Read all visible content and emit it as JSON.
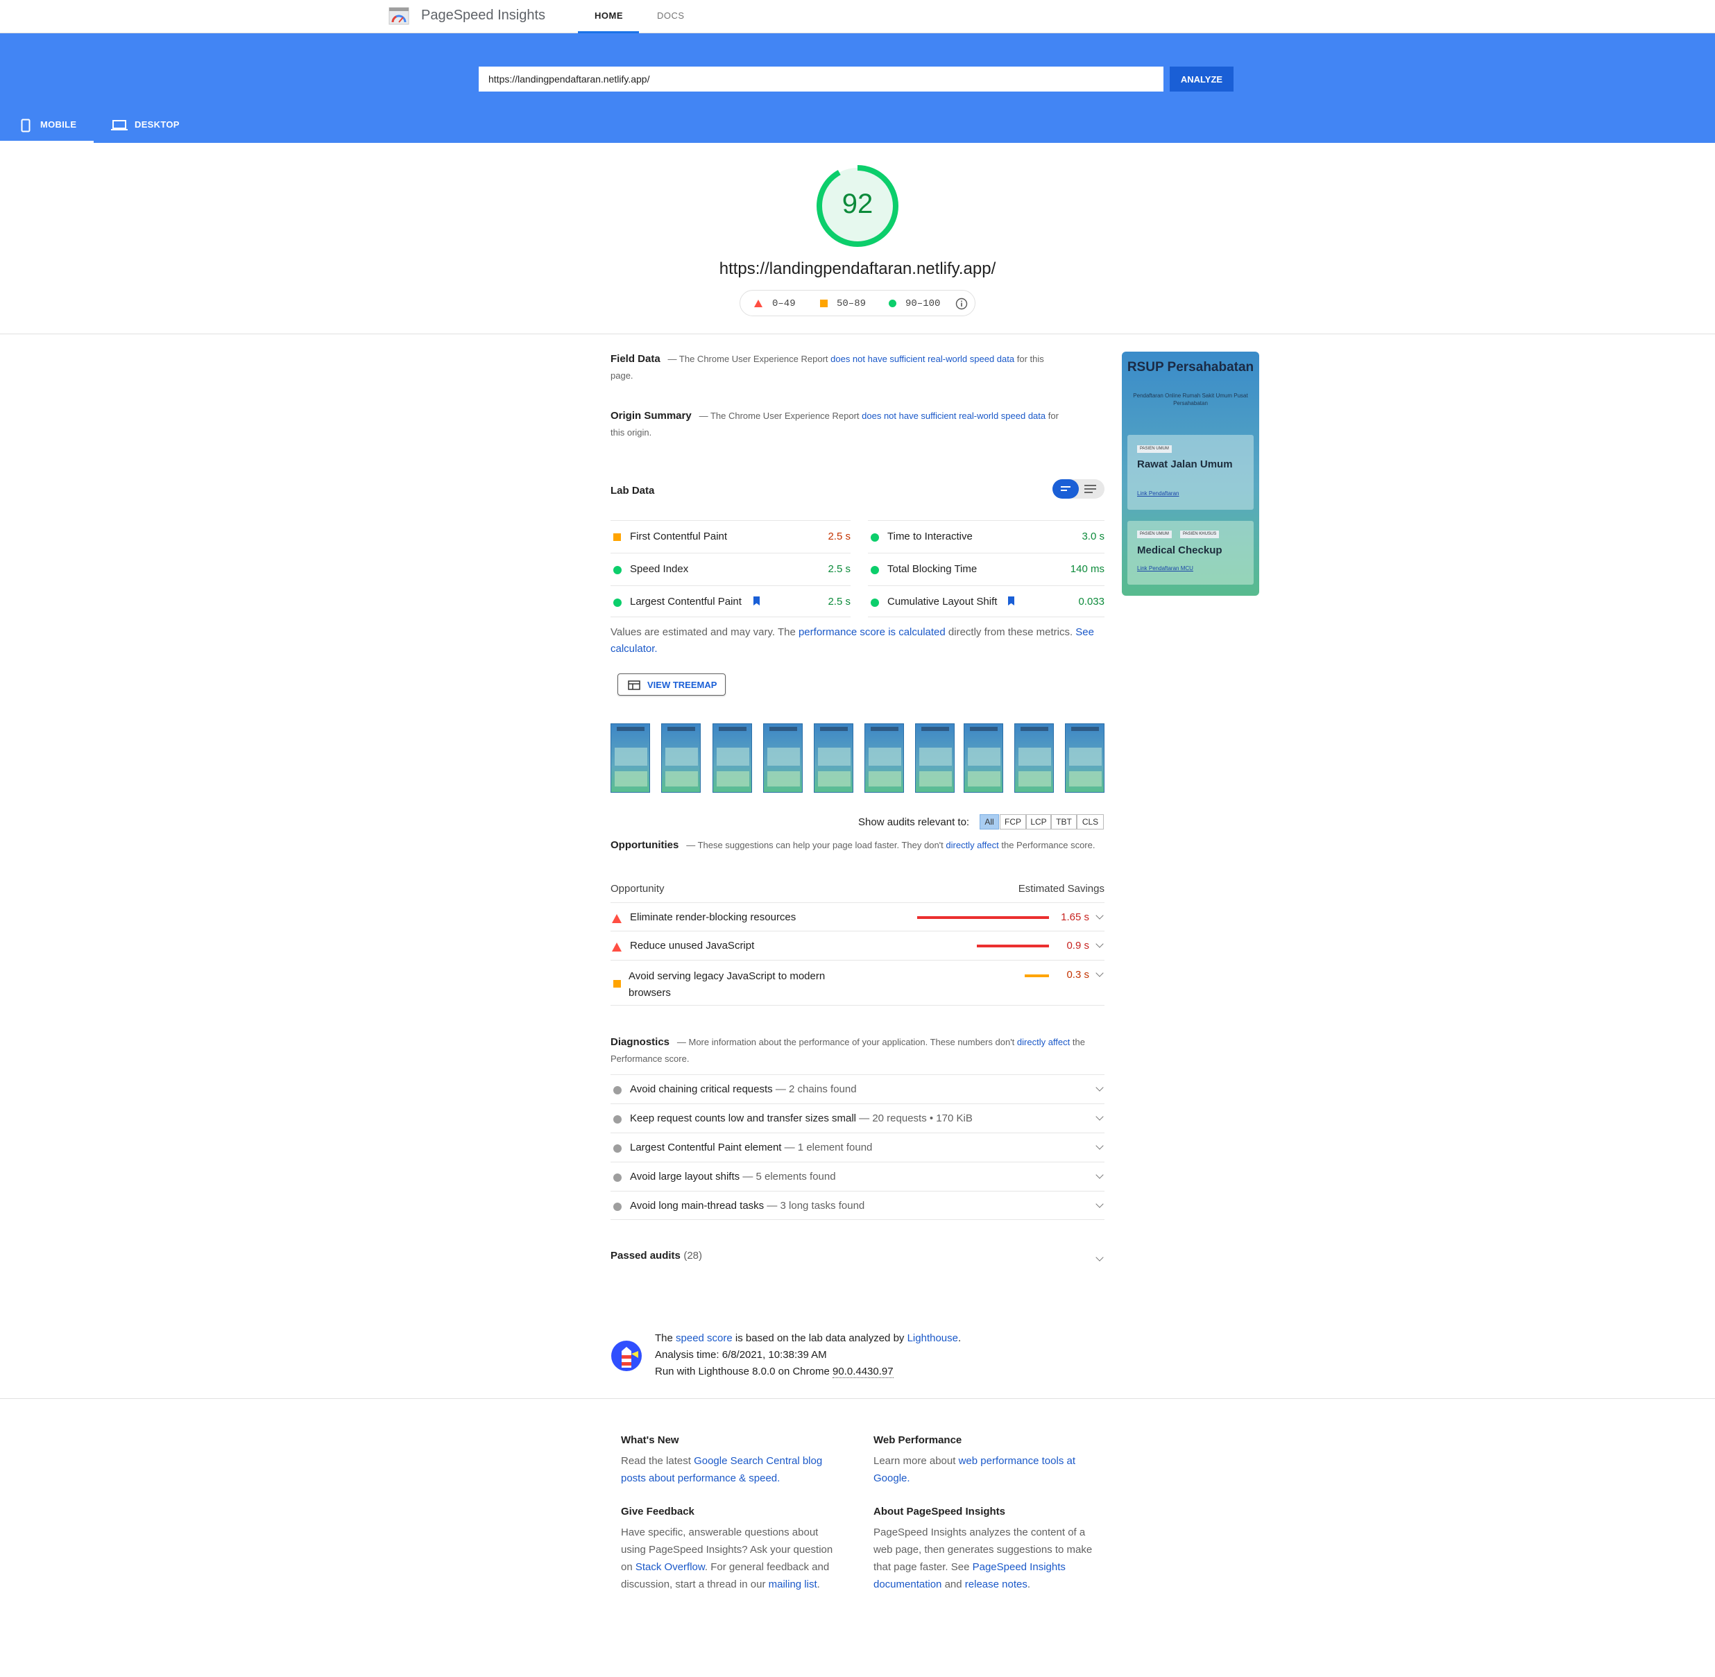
{
  "header": {
    "brand": "PageSpeed Insights",
    "nav": [
      "HOME",
      "DOCS"
    ]
  },
  "search": {
    "url_value": "https://landingpendaftaran.netlify.app/",
    "analyze_label": "ANALYZE"
  },
  "device_tabs": [
    "MOBILE",
    "DESKTOP"
  ],
  "score": {
    "value": 92,
    "url": "https://landingpendaftaran.netlify.app/",
    "legend": [
      "0–49",
      "50–89",
      "90–100"
    ],
    "colors": {
      "fail": "#ff4e42",
      "average": "#ffa400",
      "pass": "#0cce6b"
    }
  },
  "field_data": {
    "title": "Field Data",
    "pre": "— The Chrome User Experience Report ",
    "link": "does not have sufficient real-world speed data",
    "post": " for this page."
  },
  "origin_summary": {
    "title": "Origin Summary",
    "pre": "— The Chrome User Experience Report ",
    "link": "does not have sufficient real-world speed data",
    "post": " for this origin."
  },
  "lab_data": {
    "title": "Lab Data",
    "metrics": [
      {
        "label": "First Contentful Paint",
        "value": "2.5 s",
        "rating": "average"
      },
      {
        "label": "Time to Interactive",
        "value": "3.0 s",
        "rating": "pass"
      },
      {
        "label": "Speed Index",
        "value": "2.5 s",
        "rating": "pass"
      },
      {
        "label": "Total Blocking Time",
        "value": "140 ms",
        "rating": "pass"
      },
      {
        "label": "Largest Contentful Paint",
        "value": "2.5 s",
        "rating": "pass"
      },
      {
        "label": "Cumulative Layout Shift",
        "value": "0.033",
        "rating": "pass"
      }
    ],
    "note_pre": "Values are estimated and may vary. The ",
    "note_link1": "performance score is calculated",
    "note_mid": " directly from these metrics. ",
    "note_link2": "See calculator.",
    "treemap_label": "VIEW TREEMAP"
  },
  "preview": {
    "title": "RSUP Persahabatan",
    "subtitle": "Pendaftaran Online Rumah Sakit Umum Pusat Persahabatan",
    "card1": {
      "badges": [
        "PASIEN UMUM"
      ],
      "title": "Rawat Jalan Umum",
      "link": "Link Pendaftaran"
    },
    "card2": {
      "badges": [
        "PASIEN UMUM",
        "PASIEN KHUSUS"
      ],
      "title": "Medical Checkup",
      "link": "Link Pendaftaran MCU"
    }
  },
  "filter": {
    "label": "Show audits relevant to:",
    "chips": [
      "All",
      "FCP",
      "LCP",
      "TBT",
      "CLS"
    ]
  },
  "opportunities": {
    "title": "Opportunities",
    "desc_pre": "— These suggestions can help your page load faster. They don't ",
    "desc_link": "directly affect",
    "desc_post": " the Performance score.",
    "col_left": "Opportunity",
    "col_right": "Estimated Savings",
    "items": [
      {
        "label": "Eliminate render-blocking resources",
        "savings": "1.65 s",
        "seconds": 1.65,
        "rating": "fail"
      },
      {
        "label": "Reduce unused JavaScript",
        "savings": "0.9 s",
        "seconds": 0.9,
        "rating": "fail"
      },
      {
        "label": "Avoid serving legacy JavaScript to modern browsers",
        "savings": "0.3 s",
        "seconds": 0.3,
        "rating": "average"
      }
    ]
  },
  "diagnostics": {
    "title": "Diagnostics",
    "desc_pre": "— More information about the performance of your application. These numbers don't ",
    "desc_link": "directly affect",
    "desc_post": " the Performance score.",
    "items": [
      {
        "label": "Avoid chaining critical requests",
        "detail": " — 2 chains found"
      },
      {
        "label": "Keep request counts low and transfer sizes small",
        "detail": " — 20 requests • 170 KiB"
      },
      {
        "label": "Largest Contentful Paint element",
        "detail": " — 1 element found"
      },
      {
        "label": "Avoid large layout shifts",
        "detail": " — 5 elements found"
      },
      {
        "label": "Avoid long main-thread tasks",
        "detail": " — 3 long tasks found"
      }
    ]
  },
  "passed": {
    "title": "Passed audits",
    "count": "(28)"
  },
  "runtime": {
    "line1_pre": "The ",
    "line1_link1": "speed score",
    "line1_mid": " is based on the lab data analyzed by ",
    "line1_link2": "Lighthouse",
    "line1_post": ".",
    "line2": "Analysis time: 6/8/2021, 10:38:39 AM",
    "line3_pre": "Run with Lighthouse 8.0.0 on Chrome ",
    "line3_version": "90.0.4430.97"
  },
  "footer": {
    "whats_new": {
      "title": "What's New",
      "pre": "Read the latest ",
      "link": "Google Search Central blog posts about performance & speed."
    },
    "web_perf": {
      "title": "Web Performance",
      "pre": "Learn more about ",
      "link": "web performance tools at Google."
    },
    "feedback": {
      "title": "Give Feedback",
      "pre": "Have specific, answerable questions about using PageSpeed Insights? Ask your question on ",
      "link1": "Stack Overflow",
      "mid": ". For general feedback and discussion, start a thread in our ",
      "link2": "mailing list",
      "post": "."
    },
    "about": {
      "title": "About PageSpeed Insights",
      "pre": "PageSpeed Insights analyzes the content of a web page, then generates suggestions to make that page faster. See ",
      "link1": "PageSpeed Insights documentation",
      "mid": " and ",
      "link2": "release notes",
      "post": "."
    }
  }
}
